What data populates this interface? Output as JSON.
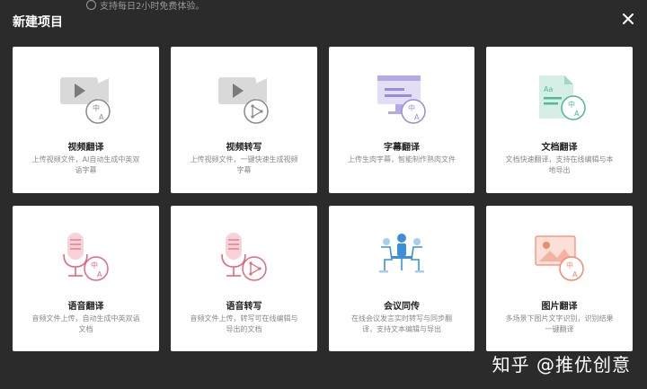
{
  "header": {
    "note": "支持每日2小时免费体验。",
    "title": "新建项目"
  },
  "cards": [
    {
      "name": "视频翻译",
      "desc": "上传视频文件，AI自动生成中英双语字幕",
      "icon": "video-translate-icon",
      "accent": "#8a8a8a"
    },
    {
      "name": "视频转写",
      "desc": "上传视频文件，一键快速生成视频字幕",
      "icon": "video-transcribe-icon",
      "accent": "#8a8a8a"
    },
    {
      "name": "字幕翻译",
      "desc": "上传生肉字幕，智能制作熟肉文件",
      "icon": "subtitle-translate-icon",
      "accent": "#9b8cd6"
    },
    {
      "name": "文档翻译",
      "desc": "文档快速翻译，支持在线编辑与本地导出",
      "icon": "document-translate-icon",
      "accent": "#4fb89a"
    },
    {
      "name": "语音翻译",
      "desc": "音频文件上传，自动生成中英双语文档",
      "icon": "audio-translate-icon",
      "accent": "#e06a7c"
    },
    {
      "name": "语音转写",
      "desc": "音频文件上传，转写可在线编辑与导出的文档",
      "icon": "audio-transcribe-icon",
      "accent": "#e06a7c"
    },
    {
      "name": "会议同传",
      "desc": "在线会议发言实时转写与同步翻译，支持文本编辑与导出",
      "icon": "meeting-interpret-icon",
      "accent": "#3f8fd8"
    },
    {
      "name": "图片翻译",
      "desc": "多场景下图片文字识别，识别结果一键翻译",
      "icon": "image-translate-icon",
      "accent": "#ef8a6f"
    }
  ],
  "watermark": "知乎 @推优创意"
}
